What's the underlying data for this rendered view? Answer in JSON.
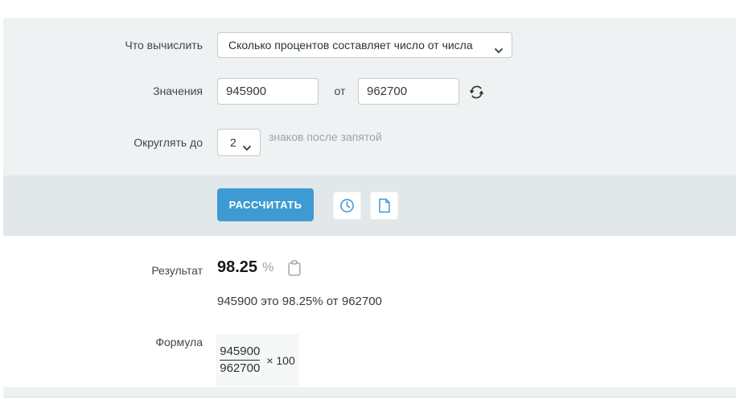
{
  "form": {
    "what_label": "Что вычислить",
    "what_value": "Сколько процентов составляет число от числа",
    "values_label": "Значения",
    "value1": "945900",
    "of_label": "от",
    "value2": "962700",
    "round_label": "Округлять до",
    "round_value": "2",
    "round_suffix": "знаков после запятой"
  },
  "actions": {
    "calculate_label": "РАССЧИТАТЬ",
    "history_icon": "clock-icon",
    "report_icon": "document-icon"
  },
  "result": {
    "label": "Результат",
    "value": "98.25",
    "unit": "%",
    "copy_icon": "clipboard-icon",
    "sentence": "945900 это 98.25% от 962700"
  },
  "formula": {
    "label": "Формула",
    "numerator": "945900",
    "denominator": "962700",
    "multiplier": "× 100"
  },
  "colors": {
    "accent_blue": "#3e9ad3",
    "panel_bg": "#eef2f2",
    "band_bg": "#e2e8e9",
    "muted_text": "#98a5b1",
    "input_border": "#c6cbce"
  }
}
